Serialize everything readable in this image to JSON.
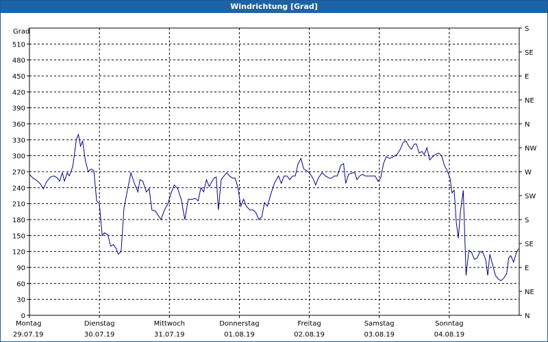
{
  "window": {
    "title": "Windrichtung [Grad]"
  },
  "chart_data": {
    "type": "line",
    "title": "Windrichtung [Grad]",
    "ylabel": "Grad",
    "ylim": [
      0,
      540
    ],
    "yticks": [
      0,
      30,
      60,
      90,
      120,
      150,
      180,
      210,
      240,
      270,
      300,
      330,
      360,
      390,
      420,
      450,
      480,
      510
    ],
    "right_axis": [
      {
        "value": 0,
        "label": "N"
      },
      {
        "value": 45,
        "label": "NE"
      },
      {
        "value": 90,
        "label": "E"
      },
      {
        "value": 135,
        "label": "SE"
      },
      {
        "value": 180,
        "label": "S"
      },
      {
        "value": 225,
        "label": "SW"
      },
      {
        "value": 270,
        "label": "W"
      },
      {
        "value": 315,
        "label": "NW"
      },
      {
        "value": 360,
        "label": "N"
      },
      {
        "value": 405,
        "label": "NE"
      },
      {
        "value": 450,
        "label": "E"
      },
      {
        "value": 495,
        "label": "SE"
      },
      {
        "value": 540,
        "label": "S"
      }
    ],
    "xlim": [
      0,
      7
    ],
    "x_categories": [
      {
        "day": "Montag",
        "date": "29.07.19"
      },
      {
        "day": "Dienstag",
        "date": "30.07.19"
      },
      {
        "day": "Mittwoch",
        "date": "31.07.19"
      },
      {
        "day": "Donnerstag",
        "date": "01.08.19"
      },
      {
        "day": "Freitag",
        "date": "02.08.19"
      },
      {
        "day": "Samstag",
        "date": "03.08.19"
      },
      {
        "day": "Sonntag",
        "date": "04.08.19"
      }
    ],
    "grid": true,
    "line_color": "#00008b",
    "series": [
      {
        "values": [
          [
            0.0,
            265
          ],
          [
            0.05,
            258
          ],
          [
            0.1,
            254
          ],
          [
            0.15,
            248
          ],
          [
            0.2,
            238
          ],
          [
            0.24,
            250
          ],
          [
            0.3,
            260
          ],
          [
            0.35,
            262
          ],
          [
            0.4,
            258
          ],
          [
            0.43,
            252
          ],
          [
            0.47,
            268
          ],
          [
            0.5,
            252
          ],
          [
            0.54,
            268
          ],
          [
            0.57,
            262
          ],
          [
            0.62,
            280
          ],
          [
            0.67,
            330
          ],
          [
            0.7,
            340
          ],
          [
            0.73,
            318
          ],
          [
            0.76,
            328
          ],
          [
            0.8,
            290
          ],
          [
            0.84,
            270
          ],
          [
            0.88,
            275
          ],
          [
            0.92,
            272
          ],
          [
            0.96,
            215
          ],
          [
            1.0,
            210
          ],
          [
            1.04,
            150
          ],
          [
            1.07,
            155
          ],
          [
            1.12,
            152
          ],
          [
            1.16,
            130
          ],
          [
            1.2,
            133
          ],
          [
            1.24,
            125
          ],
          [
            1.27,
            115
          ],
          [
            1.31,
            120
          ],
          [
            1.35,
            200
          ],
          [
            1.4,
            235
          ],
          [
            1.45,
            268
          ],
          [
            1.5,
            248
          ],
          [
            1.55,
            232
          ],
          [
            1.58,
            255
          ],
          [
            1.62,
            252
          ],
          [
            1.67,
            232
          ],
          [
            1.71,
            238
          ],
          [
            1.75,
            198
          ],
          [
            1.8,
            196
          ],
          [
            1.84,
            188
          ],
          [
            1.88,
            180
          ],
          [
            1.93,
            198
          ],
          [
            1.98,
            210
          ],
          [
            2.02,
            228
          ],
          [
            2.07,
            245
          ],
          [
            2.12,
            238
          ],
          [
            2.17,
            218
          ],
          [
            2.22,
            180
          ],
          [
            2.27,
            218
          ],
          [
            2.33,
            218
          ],
          [
            2.37,
            220
          ],
          [
            2.41,
            215
          ],
          [
            2.45,
            240
          ],
          [
            2.49,
            232
          ],
          [
            2.53,
            255
          ],
          [
            2.57,
            242
          ],
          [
            2.6,
            250
          ],
          [
            2.64,
            258
          ],
          [
            2.67,
            260
          ],
          [
            2.7,
            198
          ],
          [
            2.74,
            255
          ],
          [
            2.78,
            262
          ],
          [
            2.82,
            268
          ],
          [
            2.86,
            262
          ],
          [
            2.9,
            258
          ],
          [
            2.94,
            258
          ],
          [
            2.98,
            240
          ],
          [
            3.02,
            205
          ],
          [
            3.06,
            218
          ],
          [
            3.1,
            205
          ],
          [
            3.15,
            198
          ],
          [
            3.2,
            198
          ],
          [
            3.24,
            192
          ],
          [
            3.28,
            180
          ],
          [
            3.32,
            185
          ],
          [
            3.36,
            212
          ],
          [
            3.4,
            205
          ],
          [
            3.45,
            228
          ],
          [
            3.5,
            248
          ],
          [
            3.56,
            262
          ],
          [
            3.6,
            248
          ],
          [
            3.64,
            262
          ],
          [
            3.68,
            262
          ],
          [
            3.72,
            255
          ],
          [
            3.76,
            262
          ],
          [
            3.8,
            262
          ],
          [
            3.84,
            285
          ],
          [
            3.88,
            295
          ],
          [
            3.92,
            275
          ],
          [
            3.96,
            272
          ],
          [
            4.0,
            268
          ],
          [
            4.05,
            258
          ],
          [
            4.09,
            245
          ],
          [
            4.13,
            258
          ],
          [
            4.18,
            268
          ],
          [
            4.23,
            262
          ],
          [
            4.28,
            258
          ],
          [
            4.32,
            258
          ],
          [
            4.36,
            262
          ],
          [
            4.4,
            262
          ],
          [
            4.45,
            282
          ],
          [
            4.49,
            285
          ],
          [
            4.52,
            248
          ],
          [
            4.56,
            265
          ],
          [
            4.62,
            268
          ],
          [
            4.65,
            268
          ],
          [
            4.68,
            255
          ],
          [
            4.72,
            262
          ],
          [
            4.76,
            265
          ],
          [
            4.8,
            262
          ],
          [
            4.85,
            262
          ],
          [
            4.9,
            262
          ],
          [
            4.94,
            262
          ],
          [
            4.98,
            252
          ],
          [
            5.02,
            258
          ],
          [
            5.06,
            285
          ],
          [
            5.1,
            298
          ],
          [
            5.15,
            295
          ],
          [
            5.2,
            298
          ],
          [
            5.25,
            302
          ],
          [
            5.3,
            312
          ],
          [
            5.34,
            325
          ],
          [
            5.38,
            328
          ],
          [
            5.42,
            318
          ],
          [
            5.46,
            312
          ],
          [
            5.5,
            322
          ],
          [
            5.53,
            322
          ],
          [
            5.57,
            305
          ],
          [
            5.61,
            308
          ],
          [
            5.64,
            302
          ],
          [
            5.68,
            315
          ],
          [
            5.72,
            292
          ],
          [
            5.76,
            298
          ],
          [
            5.8,
            302
          ],
          [
            5.85,
            305
          ],
          [
            5.89,
            300
          ],
          [
            5.93,
            282
          ],
          [
            5.97,
            272
          ],
          [
            6.01,
            258
          ],
          [
            6.04,
            230
          ],
          [
            6.07,
            235
          ],
          [
            6.1,
            175
          ],
          [
            6.13,
            145
          ],
          [
            6.16,
            195
          ],
          [
            6.2,
            235
          ],
          [
            6.24,
            75
          ],
          [
            6.28,
            122
          ],
          [
            6.32,
            118
          ],
          [
            6.36,
            105
          ],
          [
            6.4,
            108
          ],
          [
            6.44,
            120
          ],
          [
            6.48,
            118
          ],
          [
            6.52,
            105
          ],
          [
            6.55,
            75
          ],
          [
            6.58,
            115
          ],
          [
            6.62,
            95
          ],
          [
            6.66,
            75
          ],
          [
            6.7,
            68
          ],
          [
            6.74,
            65
          ],
          [
            6.78,
            70
          ],
          [
            6.82,
            78
          ],
          [
            6.85,
            108
          ],
          [
            6.88,
            112
          ],
          [
            6.92,
            100
          ],
          [
            6.96,
            118
          ],
          [
            6.99,
            125
          ]
        ]
      }
    ]
  }
}
